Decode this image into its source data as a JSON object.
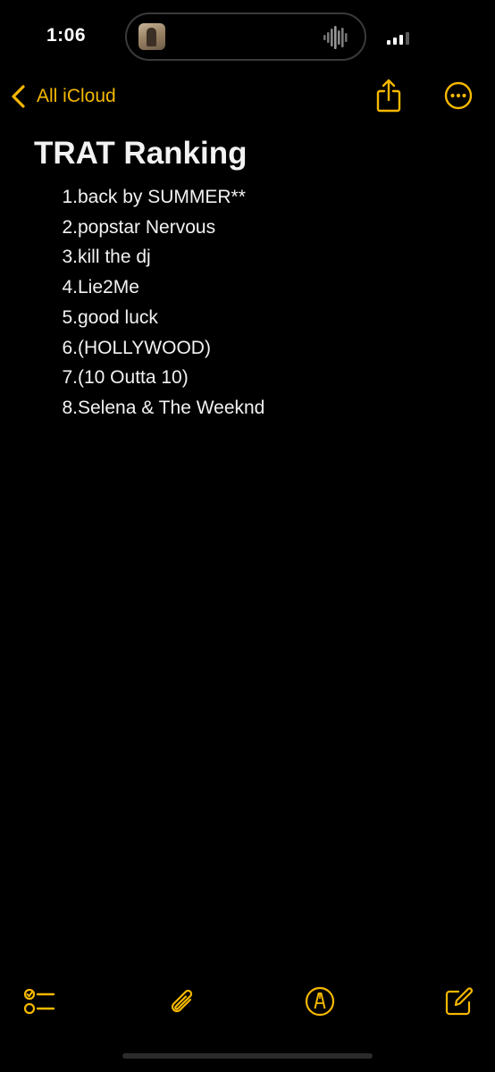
{
  "status_bar": {
    "time": "1:06"
  },
  "nav": {
    "back_label": "All iCloud"
  },
  "note": {
    "title": "TRAT Ranking",
    "items": [
      {
        "num": "1.",
        "text": "back by SUMMER**"
      },
      {
        "num": "2.",
        "text": "popstar Nervous"
      },
      {
        "num": "3.",
        "text": "kill the dj"
      },
      {
        "num": "4.",
        "text": "Lie2Me"
      },
      {
        "num": "5.",
        "text": "good luck"
      },
      {
        "num": "6.",
        "text": "(HOLLYWOOD)"
      },
      {
        "num": "7.",
        "text": "(10 Outta 10)"
      },
      {
        "num": "8.",
        "text": "Selena & The Weeknd"
      }
    ]
  },
  "icons": {
    "back": "chevron-left-icon",
    "share": "share-icon",
    "more": "ellipsis-circle-icon",
    "checklist": "checklist-icon",
    "attach": "paperclip-icon",
    "markup": "markup-pen-icon",
    "compose": "compose-icon"
  },
  "colors": {
    "accent": "#f5b800",
    "background": "#000000",
    "text": "#f2f2f2"
  }
}
